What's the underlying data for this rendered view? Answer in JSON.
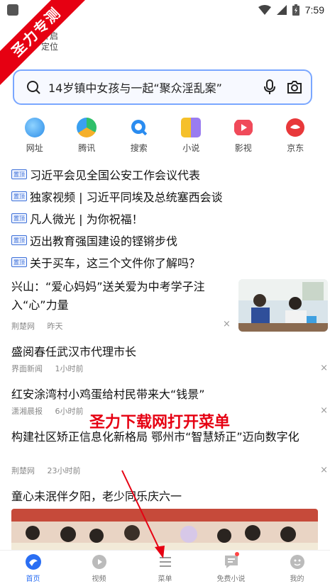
{
  "status_bar": {
    "time": "7:59"
  },
  "watermark": {
    "ribbon_text": "圣力专测",
    "overlay_text": "圣力下载网打开菜单"
  },
  "weather": {
    "line1": "开启",
    "line2": "定位"
  },
  "search": {
    "query": "14岁镇中女孩与一起“聚众淫乱案”"
  },
  "quick_nav": [
    {
      "label": "网址",
      "icon": "bird-icon",
      "color": "#3aa0f0"
    },
    {
      "label": "腾讯",
      "icon": "tencent-icon",
      "color": "#2fbf6a"
    },
    {
      "label": "搜索",
      "icon": "search-icon",
      "color": "#2a8cf0"
    },
    {
      "label": "小说",
      "icon": "book-icon",
      "color": "#f5c02a"
    },
    {
      "label": "影视",
      "icon": "play-icon",
      "color": "#f04a5a"
    },
    {
      "label": "京东",
      "icon": "jd-icon",
      "color": "#e8383a"
    }
  ],
  "pinned": {
    "tag": "置顶",
    "items": [
      "习近平会见全国公安工作会议代表",
      "独家视频 | 习近平同埃及总统塞西会谈",
      "凡人微光 | 为你祝福！",
      "迈出教育强国建设的铿锵步伐",
      "关于买车，这三个文件你了解吗？"
    ]
  },
  "feed": [
    {
      "title": "兴山：“爱心妈妈”送关爱为中考学子注入“心”力量",
      "source": "荆楚网",
      "time": "昨天"
    },
    {
      "title": "盛阅春任武汉市代理市长",
      "source": "界面新闻",
      "time": "1小时前"
    },
    {
      "title": "红安涂湾村小鸡蛋给村民带来大“钱景”",
      "source": "潇湘晨报",
      "time": "6小时前"
    },
    {
      "title": "构建社区矫正信息化新格局 鄂州市“智慧矫正”迈向数字化",
      "source": "荆楚网",
      "time": "23小时前"
    },
    {
      "title": "童心未泯伴夕阳，老少同乐庆六一"
    }
  ],
  "close_glyph": "×",
  "tabbar": [
    {
      "label": "首页",
      "active": true
    },
    {
      "label": "视频"
    },
    {
      "label": "菜单"
    },
    {
      "label": "免费小说"
    },
    {
      "label": "我的"
    }
  ]
}
